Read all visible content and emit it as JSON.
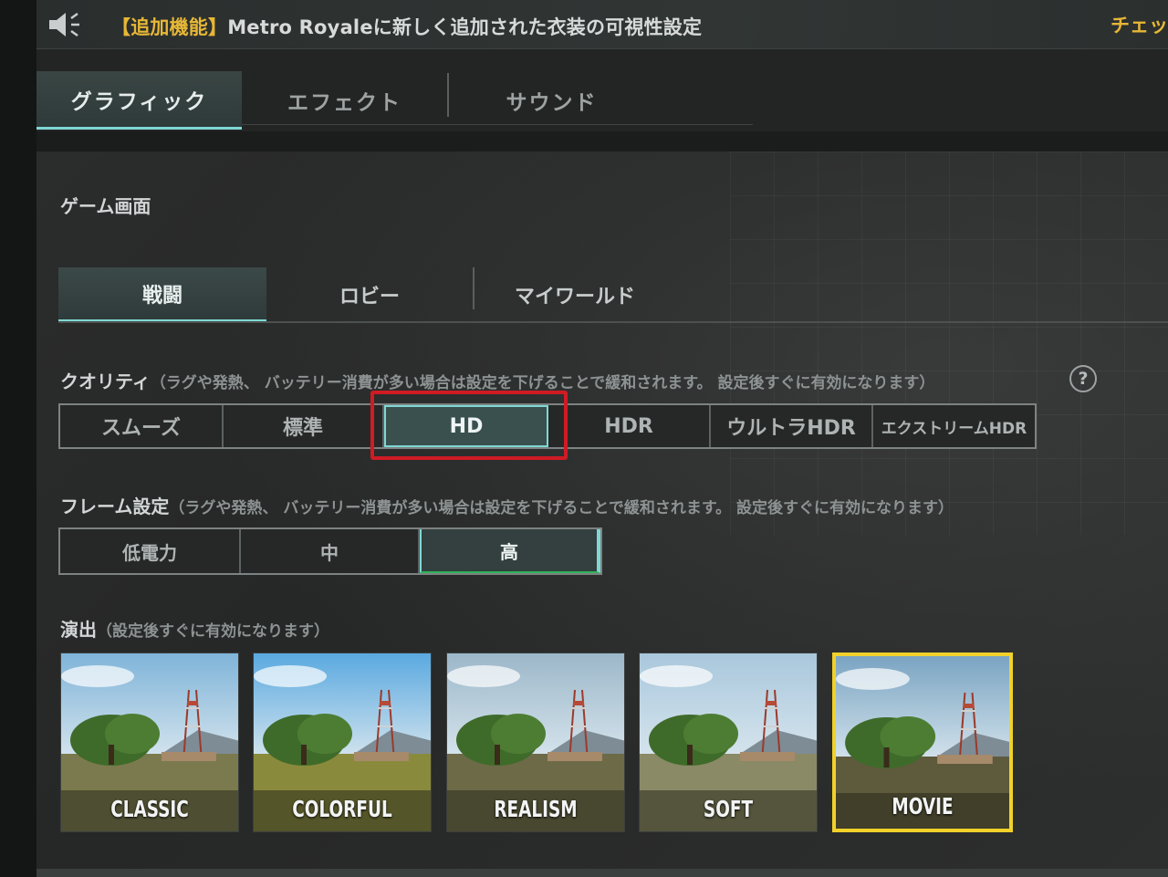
{
  "notice": {
    "tag": "【追加機能】",
    "text": "Metro Royaleに新しく追加された衣装の可視性設定",
    "right_text": "チェッ"
  },
  "top_tabs": [
    {
      "label": "グラフィック",
      "active": true
    },
    {
      "label": "エフェクト",
      "active": false
    },
    {
      "label": "サウンド",
      "active": false
    }
  ],
  "game_screen": {
    "title": "ゲーム画面",
    "sub_tabs": [
      {
        "label": "戦闘",
        "active": true
      },
      {
        "label": "ロビー",
        "active": false
      },
      {
        "label": "マイワールド",
        "active": false
      }
    ]
  },
  "quality": {
    "title": "クオリティ",
    "note": "（ラグや発熱、 バッテリー消費が多い場合は設定を下げることで緩和されます。 設定後すぐに有効になります）",
    "help_icon": "?",
    "options": [
      "スムーズ",
      "標準",
      "HD",
      "HDR",
      "ウルトラHDR",
      "エクストリームHDR"
    ],
    "selected": "HD"
  },
  "frame": {
    "title": "フレーム設定",
    "note": "（ラグや発熱、 バッテリー消費が多い場合は設定を下げることで緩和されます。 設定後すぐに有効になります）",
    "options": [
      "低電力",
      "中",
      "高"
    ],
    "selected": "高"
  },
  "style": {
    "title": "演出",
    "note": "（設定後すぐに有効になります）",
    "options": [
      {
        "label": "CLASSIC",
        "sky": "#7fb4d9",
        "ground": "#7b7a4e"
      },
      {
        "label": "COLORFUL",
        "sky": "#5aa9e0",
        "ground": "#8a8a3c"
      },
      {
        "label": "REALISM",
        "sky": "#9cb7c9",
        "ground": "#6d6a48"
      },
      {
        "label": "SOFT",
        "sky": "#a9c7dc",
        "ground": "#8a8a66"
      },
      {
        "label": "MOVIE",
        "sky": "#7aa4c2",
        "ground": "#5e5a3c"
      }
    ],
    "selected": "MOVIE"
  },
  "colors": {
    "accent": "#7fd8d4",
    "highlight_red": "#d01b24",
    "selected_yellow": "#f1d12a",
    "notice_gold": "#e7b736"
  }
}
